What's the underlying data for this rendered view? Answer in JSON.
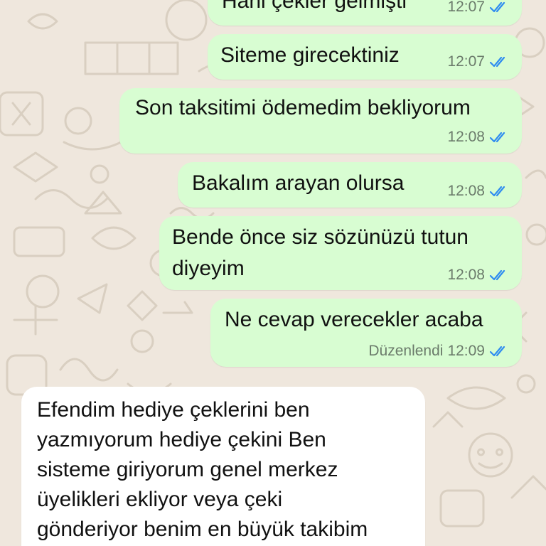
{
  "chat": {
    "messages": [
      {
        "direction": "outgoing",
        "text": "Hani çekler gelmişti",
        "time": "12:07",
        "status": "read"
      },
      {
        "direction": "outgoing",
        "text": "Siteme girecektiniz",
        "time": "12:07",
        "status": "read"
      },
      {
        "direction": "outgoing",
        "text": "Son taksitimi ödemedim bekliyorum",
        "time": "12:08",
        "status": "read"
      },
      {
        "direction": "outgoing",
        "text": "Bakalım arayan olursa",
        "time": "12:08",
        "status": "read"
      },
      {
        "direction": "outgoing",
        "text": "Bende önce siz sözünüzü tutun\ndiyeyim",
        "time": "12:08",
        "status": "read"
      },
      {
        "direction": "outgoing",
        "text": "Ne cevap verecekler acaba",
        "edited_label": "Düzenlendi",
        "time": "12:09",
        "status": "read"
      },
      {
        "direction": "incoming",
        "text": "Efendim hediye çeklerini ben\nyazmıyorum hediye çekini Ben\nsisteme giriyorum genel merkez\nüyelikleri ekliyor veya çeki\ngönderiyor benim en büyük takibim"
      }
    ]
  },
  "colors": {
    "wallpaper": "#efe7dd",
    "outgoing_bubble": "#d8fdd2",
    "incoming_bubble": "#ffffff",
    "read_ticks": "#2f8cf0"
  },
  "icons": {
    "read_status": "double-check-icon"
  }
}
